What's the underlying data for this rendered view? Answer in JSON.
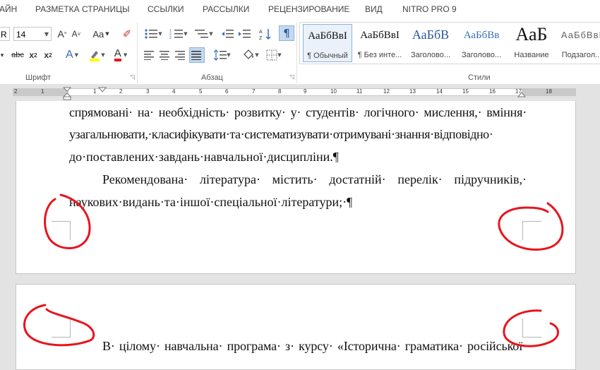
{
  "ribbon_tabs": [
    "АЙН",
    "РАЗМЕТКА СТРАНИЦЫ",
    "ССЫЛКИ",
    "РАССЫЛКИ",
    "РЕЦЕНЗИРОВАНИЕ",
    "ВИД",
    "NITRO PRO 9"
  ],
  "font_group": {
    "font_name": "R",
    "font_size": "14",
    "grow_label": "A",
    "shrink_label": "A",
    "change_case_label": "Aa",
    "strike_label": "abc",
    "subscript_label": "x",
    "subscript_sub": "2",
    "superscript_label": "x",
    "superscript_sup": "2",
    "text_effects_label": "A",
    "font_color_label": "A",
    "label": "Шрифт"
  },
  "paragraph_group": {
    "label": "Абзац"
  },
  "styles_group": {
    "label": "Стили",
    "items": [
      {
        "sample": "АаБбВвІ",
        "name": "¶ Обычный"
      },
      {
        "sample": "АаБбВвІ",
        "name": "¶ Без инте..."
      },
      {
        "sample": "АаБбВ",
        "name": "Заголово..."
      },
      {
        "sample": "АаБбВв",
        "name": "Заголово..."
      },
      {
        "sample": "АаБ",
        "name": "Название"
      },
      {
        "sample": "АаБбВвІ",
        "name": "Подзагол..."
      }
    ]
  },
  "ruler": {
    "labels": [
      "2",
      "1",
      "1",
      "2",
      "3",
      "4",
      "5",
      "6",
      "7",
      "8",
      "9",
      "10",
      "11",
      "12",
      "13",
      "14",
      "15",
      "16",
      "17",
      "18"
    ]
  },
  "document": {
    "page1_lines": [
      "спрямовані· на· необхідність· розвитку· у· студентів· логічного· мислення,· вміння·",
      "узагальнювати,·класифікувати·та·систематизувати·отримувані·знання·відповідно·",
      "до·поставлених·завдань·навчальної·дисципліни.¶",
      "Рекомендована· література· містить· достатній· перелік· підручників,·",
      "наукових·видань·та·іншої·спеціальної·літератури;·¶"
    ],
    "page2_lines": [
      "В· цілому· навчальна· програма· з· курсу· «Історична· граматика· російської·"
    ]
  },
  "colors": {
    "annotation": "#e8141c",
    "selected_button": "#c5d9ee",
    "highlight": "#ffff00",
    "font_color_bar": "#e8141c"
  }
}
